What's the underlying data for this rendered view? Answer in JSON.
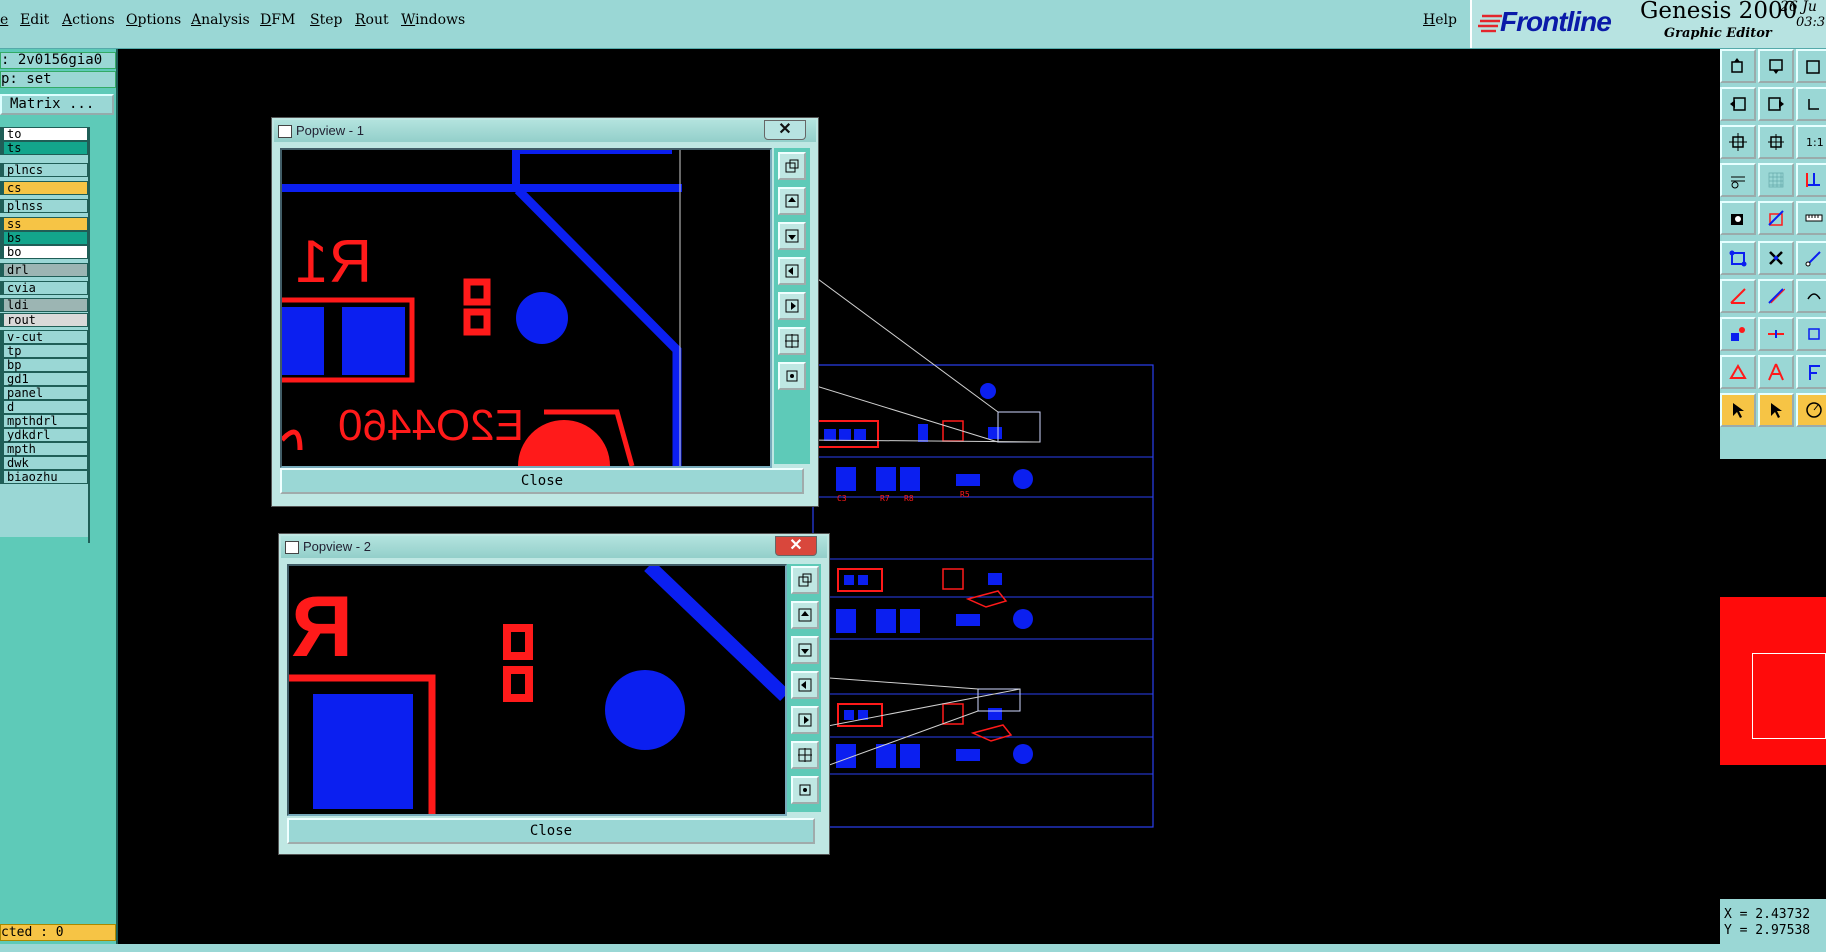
{
  "menubar": {
    "items": [
      "e",
      "Edit",
      "Actions",
      "Options",
      "Analysis",
      "DFM",
      "Step",
      "Rout",
      "Windows"
    ],
    "help": "Help"
  },
  "brand": {
    "logo": "Frontline",
    "product": "Genesis 2000",
    "subtitle": "Graphic Editor",
    "date": "26 Ju",
    "time": "03:3"
  },
  "left_panel": {
    "job": ": 2v0156gia0",
    "step": "p: set",
    "matrix_button": " Matrix ...",
    "layers": [
      {
        "name": "to",
        "color": "#ffffff"
      },
      {
        "name": "ts",
        "color": "#13a58c"
      },
      {
        "name": "plncs",
        "color": "#9ad7d5"
      },
      {
        "name": "cs",
        "color": "#f6c445"
      },
      {
        "name": "plnss",
        "color": "#9ad7d5"
      },
      {
        "name": "ss",
        "color": "#f6c445"
      },
      {
        "name": "bs",
        "color": "#13a58c"
      },
      {
        "name": "bo",
        "color": "#ffffff"
      },
      {
        "name": "drl",
        "color": "#9cb5b3"
      },
      {
        "name": "cvia",
        "color": "#9ad7d5"
      },
      {
        "name": "ldi",
        "color": "#9cb5b3"
      },
      {
        "name": "rout",
        "color": "#d9d9d9"
      },
      {
        "name": "v-cut",
        "color": "#9ad7d5"
      },
      {
        "name": "tp",
        "color": "#9ad7d5"
      },
      {
        "name": "bp",
        "color": "#9ad7d5"
      },
      {
        "name": "gd1",
        "color": "#9ad7d5"
      },
      {
        "name": "panel",
        "color": "#9ad7d5"
      },
      {
        "name": "d",
        "color": "#9ad7d5"
      },
      {
        "name": "mpthdrl",
        "color": "#9ad7d5"
      },
      {
        "name": "ydkdrl",
        "color": "#9ad7d5"
      },
      {
        "name": "mpth",
        "color": "#9ad7d5"
      },
      {
        "name": "dwk",
        "color": "#9ad7d5"
      },
      {
        "name": "biaozhu",
        "color": "#9ad7d5"
      }
    ],
    "selected": "cted : 0"
  },
  "popview1": {
    "title": "Popview - 1",
    "close_x": "✕",
    "close_label": "Close",
    "silk_text_r1": "R1",
    "silk_text_part": "E2O4460"
  },
  "popview2": {
    "title": "Popview - 2",
    "close_x": "✕",
    "close_label": "Close",
    "silk_text_r": "R"
  },
  "board_labels": {
    "c3": "C3",
    "r7": "R7",
    "r8": "R8",
    "r5": "R5"
  },
  "coords": {
    "x": "X = 2.43732",
    "y": "Y = 2.97538"
  },
  "colors": {
    "accent_teal": "#5ecab8",
    "panel_bg": "#9ad7d5",
    "trace_blue": "#0b1ff0",
    "silk_red": "#ff1a1a",
    "highlight_yellow": "#f6c445",
    "close_red": "#d9473c"
  },
  "toolbar_icons": [
    "zoom-page-icon",
    "zoom-in-icon",
    "zoom-home-icon",
    "pan-left-icon",
    "pan-right-icon",
    "pan-loop-icon",
    "zoom-fit-icon",
    "zoom-center-icon",
    "zoom-ratio-icon",
    "snap-icon",
    "grid-icon",
    "measure-icon",
    "select-point-icon",
    "draw-line-icon",
    "ruler-icon",
    "polygon-icon",
    "delete-node-icon",
    "node-edit-icon",
    "angle-icon",
    "line-icon",
    "arc-icon",
    "pad-icon",
    "midline-icon",
    "add-pad-icon",
    "triangle-icon",
    "text-a-icon",
    "text-f-icon",
    "pointer-icon",
    "select-arrow-icon",
    "rotate-icon"
  ]
}
